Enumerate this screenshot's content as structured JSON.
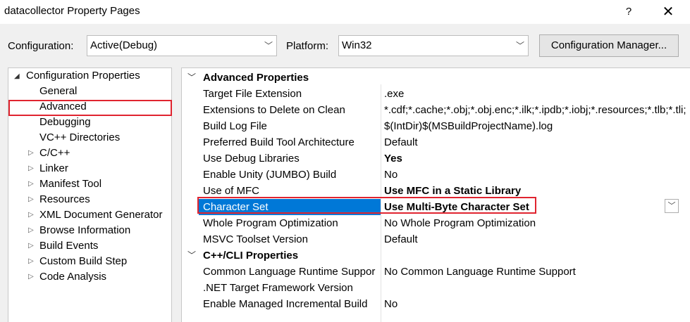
{
  "window": {
    "title": "datacollector Property Pages",
    "help_label": "?",
    "close_label": "✕"
  },
  "toolbar": {
    "configuration_label": "Configuration:",
    "configuration_value": "Active(Debug)",
    "platform_label": "Platform:",
    "platform_value": "Win32",
    "config_manager_label": "Configuration Manager..."
  },
  "tree": {
    "root": "Configuration Properties",
    "items": [
      {
        "label": "General",
        "expandable": false
      },
      {
        "label": "Advanced",
        "expandable": false,
        "selected": true
      },
      {
        "label": "Debugging",
        "expandable": false
      },
      {
        "label": "VC++ Directories",
        "expandable": false
      },
      {
        "label": "C/C++",
        "expandable": true
      },
      {
        "label": "Linker",
        "expandable": true
      },
      {
        "label": "Manifest Tool",
        "expandable": true
      },
      {
        "label": "Resources",
        "expandable": true
      },
      {
        "label": "XML Document Generator",
        "expandable": true
      },
      {
        "label": "Browse Information",
        "expandable": true
      },
      {
        "label": "Build Events",
        "expandable": true
      },
      {
        "label": "Custom Build Step",
        "expandable": true
      },
      {
        "label": "Code Analysis",
        "expandable": true
      }
    ]
  },
  "grid": {
    "categories": [
      {
        "title": "Advanced Properties",
        "rows": [
          {
            "name": "Target File Extension",
            "value": ".exe"
          },
          {
            "name": "Extensions to Delete on Clean",
            "value": "*.cdf;*.cache;*.obj;*.obj.enc;*.ilk;*.ipdb;*.iobj;*.resources;*.tlb;*.tli;"
          },
          {
            "name": "Build Log File",
            "value": "$(IntDir)$(MSBuildProjectName).log"
          },
          {
            "name": "Preferred Build Tool Architecture",
            "value": "Default"
          },
          {
            "name": "Use Debug Libraries",
            "value": "Yes",
            "bold": true
          },
          {
            "name": "Enable Unity (JUMBO) Build",
            "value": "No"
          },
          {
            "name": "Use of MFC",
            "value": "Use MFC in a Static Library",
            "bold": true
          },
          {
            "name": "Character Set",
            "value": "Use Multi-Byte Character Set",
            "bold": true,
            "selected": true
          },
          {
            "name": "Whole Program Optimization",
            "value": "No Whole Program Optimization"
          },
          {
            "name": "MSVC Toolset Version",
            "value": "Default"
          }
        ]
      },
      {
        "title": "C++/CLI Properties",
        "rows": [
          {
            "name": "Common Language Runtime Suppor",
            "value": "No Common Language Runtime Support"
          },
          {
            "name": ".NET Target Framework Version",
            "value": ""
          },
          {
            "name": "Enable Managed Incremental Build",
            "value": "No"
          }
        ]
      }
    ]
  },
  "colors": {
    "selection": "#0078d7",
    "highlight_box": "#e0242f"
  }
}
